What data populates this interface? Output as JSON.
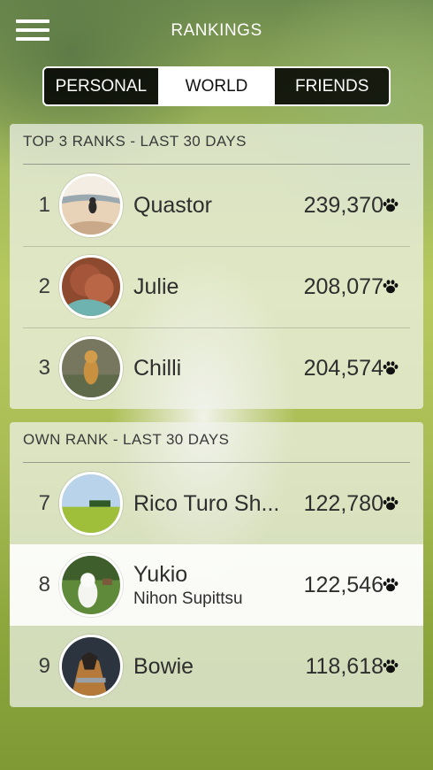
{
  "header": {
    "title": "RANKINGS",
    "menu_icon": "hamburger-menu-icon"
  },
  "tabs": [
    {
      "label": "PERSONAL",
      "active": false
    },
    {
      "label": "WORLD",
      "active": true
    },
    {
      "label": "FRIENDS",
      "active": false
    }
  ],
  "top3": {
    "heading": "TOP 3 RANKS - LAST 30 DAYS",
    "rows": [
      {
        "rank": "1",
        "name": "Quastor",
        "score": "239,370"
      },
      {
        "rank": "2",
        "name": "Julie",
        "score": "208,077"
      },
      {
        "rank": "3",
        "name": "Chilli",
        "score": "204,574"
      }
    ]
  },
  "own": {
    "heading": "OWN RANK - LAST 30 DAYS",
    "rows": [
      {
        "rank": "7",
        "name": "Rico Turo Sh...",
        "score": "122,780"
      },
      {
        "rank": "8",
        "name": "Yukio",
        "breed": "Nihon Supittsu",
        "score": "122,546"
      },
      {
        "rank": "9",
        "name": "Bowie",
        "score": "118,618"
      }
    ]
  },
  "score_icon": "paw-icon",
  "colors": {
    "active_tab_bg": "#ffffff",
    "inactive_tab_bg": "#000000",
    "highlight_row": "#ffffff"
  }
}
